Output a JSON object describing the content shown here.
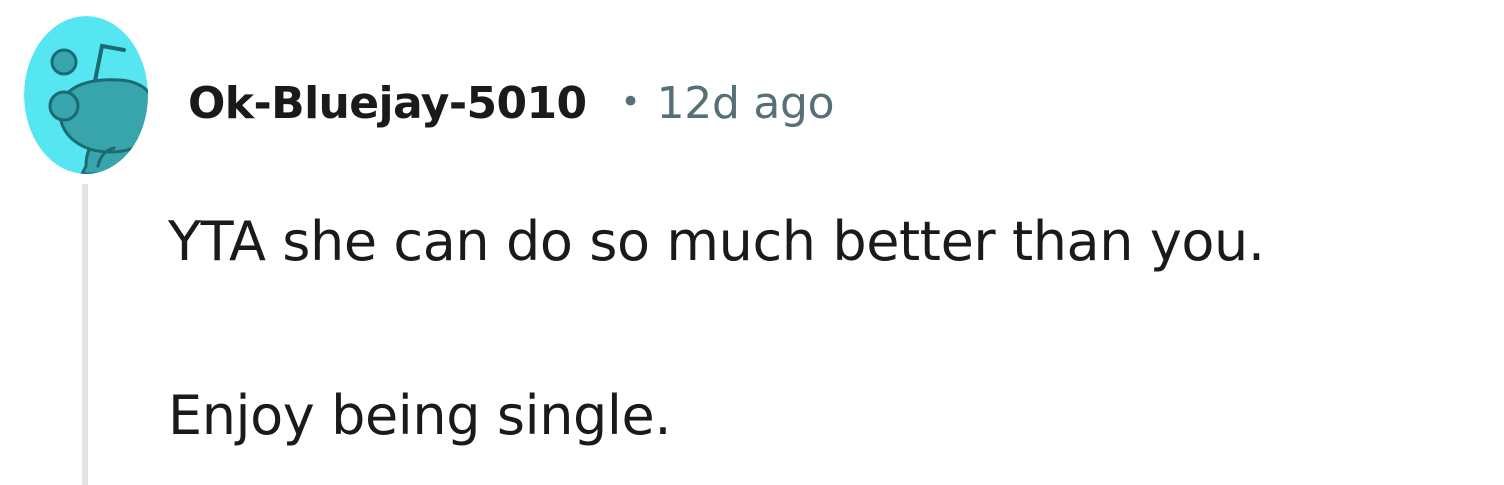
{
  "comment": {
    "author": "Ok-Bluejay-5010",
    "separator": "•",
    "timestamp": "12d ago",
    "body": [
      "YTA she can do so much better than you.",
      "Enjoy being single."
    ],
    "avatar": {
      "icon": "snoo-avatar-icon",
      "background_color": "#55e6f2",
      "figure_color": "#38a4ac",
      "outline_color": "#1c6a72"
    }
  }
}
